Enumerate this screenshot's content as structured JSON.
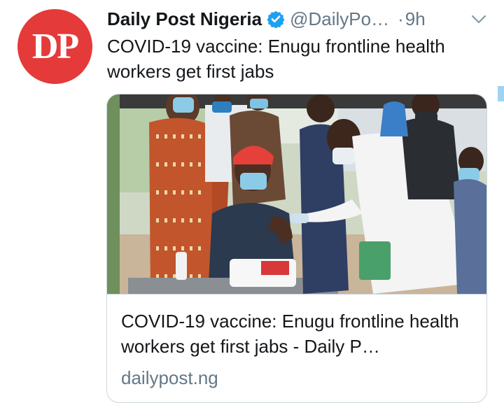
{
  "tweet": {
    "avatar_text": "DP",
    "display_name": "Daily Post Nigeria",
    "handle": "@DailyPo…",
    "dot": "·",
    "time": "9h",
    "text": "COVID-19 vaccine: Enugu frontline health workers get first jabs",
    "icons": {
      "verified": "verified-badge-icon",
      "more": "chevron-down-icon"
    }
  },
  "card": {
    "image": "vaccination-photo",
    "title": "COVID-19 vaccine: Enugu frontline health workers get first jabs - Daily P…",
    "domain": "dailypost.ng"
  },
  "colors": {
    "brand_red": "#e53a3a",
    "verified_blue": "#1da1f2",
    "secondary_text": "#657786",
    "border": "#ccd6dd"
  }
}
